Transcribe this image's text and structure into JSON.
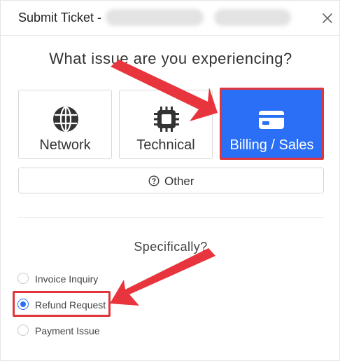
{
  "dialog": {
    "title": "Submit Ticket -",
    "close_icon": "close-icon"
  },
  "question": "What issue are you experiencing?",
  "categories": [
    {
      "label": "Network",
      "icon": "globe-icon",
      "selected": false
    },
    {
      "label": "Technical",
      "icon": "chip-icon",
      "selected": false
    },
    {
      "label": "Billing / Sales",
      "icon": "credit-card-icon",
      "selected": true
    }
  ],
  "other": {
    "label": "Other",
    "icon": "question-circle-icon"
  },
  "specifically": "Specifically?",
  "options": [
    {
      "label": "Invoice Inquiry",
      "checked": false
    },
    {
      "label": "Refund Request",
      "checked": true
    },
    {
      "label": "Payment Issue",
      "checked": false
    }
  ],
  "colors": {
    "accent": "#2a6ff5",
    "highlight": "#e0353d"
  }
}
